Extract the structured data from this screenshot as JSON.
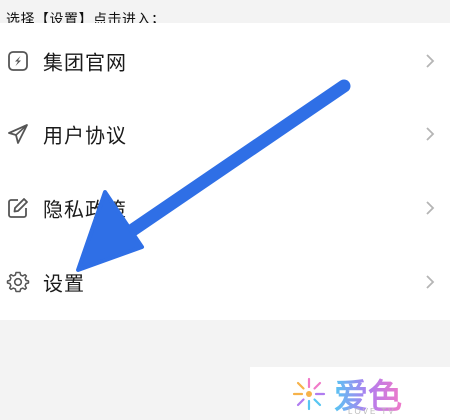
{
  "instruction": "选择【设置】点击进入；",
  "menu": [
    {
      "label": "集团官网",
      "icon": "compass-icon"
    },
    {
      "label": "用户协议",
      "icon": "paper-plane-icon"
    },
    {
      "label": "隐私政策",
      "icon": "edit-icon"
    },
    {
      "label": "设置",
      "icon": "gear-icon"
    }
  ],
  "annotation": {
    "arrow_color": "#2f6fe6"
  },
  "watermark": {
    "text": "爱色",
    "subtext": "LOVE TV"
  },
  "colors": {
    "background": "#f3f3f3",
    "row": "#ffffff",
    "chevron": "#b5b5b5"
  }
}
